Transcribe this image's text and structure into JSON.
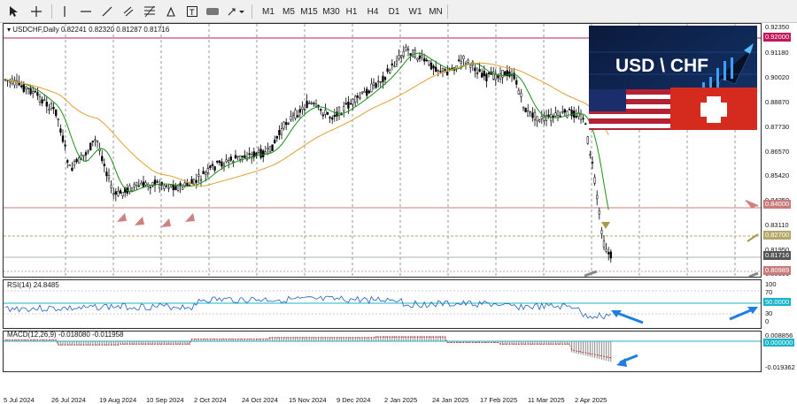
{
  "toolbar": {
    "timeframes": [
      "M1",
      "M5",
      "M15",
      "M30",
      "H1",
      "H4",
      "D1",
      "W1",
      "MN"
    ]
  },
  "chart_data": {
    "type": "candlestick",
    "symbol_line": "USDCHF,Daily",
    "ohlc_text": "0.82241 0.82320 0.81287 0.81716",
    "price_ticks": [
      "0.92350",
      "0.91180",
      "0.90020",
      "0.88870",
      "0.87730",
      "0.86570",
      "0.85420",
      "0.84250",
      "0.83110",
      "0.81950",
      "0.80800"
    ],
    "price_tags": [
      {
        "label": "0.92000",
        "color": "#c2185b"
      },
      {
        "label": "0.84000",
        "color": "#c97b7b"
      },
      {
        "label": "0.82700",
        "color": "#b5a66a"
      },
      {
        "label": "0.81716",
        "color": "#555555"
      },
      {
        "label": "0.80989",
        "color": "#c97b7b"
      }
    ],
    "x_labels": [
      "5 Jul 2024",
      "26 Jul 2024",
      "19 Aug 2024",
      "10 Sep 2024",
      "2 Oct 2024",
      "24 Oct 2024",
      "15 Nov 2024",
      "9 Dec 2024",
      "2 Jan 2025",
      "24 Jan 2025",
      "17 Feb 2025",
      "11 Mar 2025",
      "2 Apr 2025"
    ],
    "rsi": {
      "label": "RSI(14) 24.8485",
      "levels": [
        "100",
        "70",
        "50.0000",
        "30",
        "0"
      ]
    },
    "macd": {
      "label": "MACD(12,26,9) -0.018080 -0.011958",
      "levels": [
        "0.008856",
        "0.000000",
        "-0.019362"
      ]
    }
  },
  "banner": {
    "title": "USD \\ CHF"
  },
  "colors": {
    "ma_fast": "#1a8f1a",
    "ma_slow": "#e0a030",
    "candle": "#000000",
    "rsi": "#1f5fbf",
    "arrow_blue": "#1e7fe0",
    "hline_magenta": "#c2185b",
    "hline_pink": "#c97b7b",
    "hline_khaki": "#b5a66a"
  }
}
